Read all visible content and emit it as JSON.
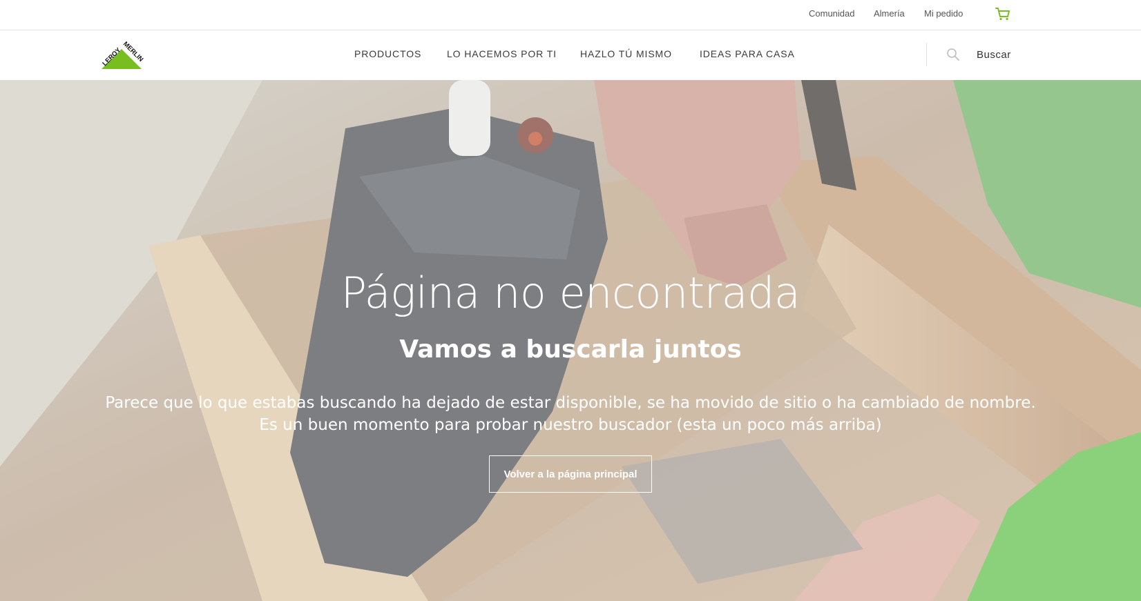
{
  "top_links": {
    "community": "Comunidad",
    "store": "Almería",
    "my_order": "Mi pedido"
  },
  "icons": {
    "cart": "cart-icon",
    "search": "search-icon"
  },
  "logo": {
    "text_left": "LEROY",
    "text_right": "MERLIN"
  },
  "nav": {
    "items": [
      {
        "label": "PRODUCTOS"
      },
      {
        "label": "LO HACEMOS POR TI"
      },
      {
        "label": "HAZLO TÚ MISMO"
      },
      {
        "label": "IDEAS PARA CASA"
      }
    ]
  },
  "search": {
    "placeholder": "Buscar"
  },
  "hero": {
    "title": "Página no encontrada",
    "subtitle": "Vamos a buscarla juntos",
    "text": "Parece que lo que estabas buscando ha dejado de estar disponible, se ha movido de sitio o ha cambiado de nombre. Es un buen momento para probar nuestro buscador (esta un poco más arriba)",
    "button_label": "Volver a la página principal"
  },
  "colors": {
    "brand_green": "#78be20",
    "text_dark": "#3a3a3a",
    "white": "#ffffff"
  }
}
